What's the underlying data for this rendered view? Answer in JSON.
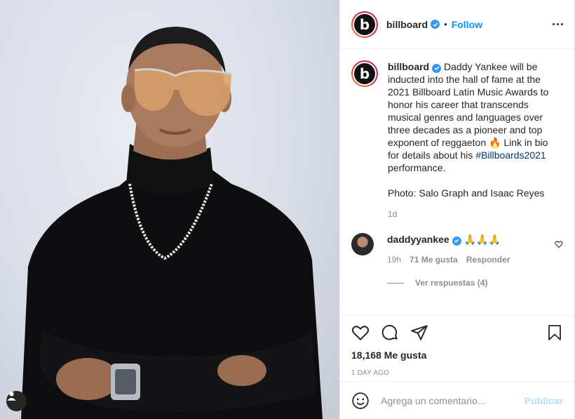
{
  "post": {
    "username": "billboard",
    "follow_label": "Follow",
    "separator": "•",
    "avatar_letter": "b",
    "caption": "Daddy Yankee will be inducted into the hall of fame at the 2021 Billboard Latin Music Awards to honor his career that transcends musical genres and languages over three decades as a pioneer and top exponent of reggaeton 🔥 Link in bio for details about his ",
    "hashtag": "#Billboards2021",
    "caption_end": " performance.",
    "photo_credit": "Photo: Salo Graph and Isaac Reyes",
    "age": "1d"
  },
  "reply": {
    "username": "daddyyankee",
    "text": "🙏🙏🙏",
    "age": "19h",
    "likes": "71 Me gusta",
    "reply_label": "Responder",
    "view_replies": "Ver respuestas (4)"
  },
  "footer": {
    "likes": "18,168 Me gusta",
    "date": "1 DAY AGO",
    "comment_placeholder": "Agrega un comentario...",
    "publish_label": "Publicar"
  },
  "colors": {
    "accent": "#0095f6",
    "verified": "#3897f0",
    "muted": "#8e8e8e"
  }
}
